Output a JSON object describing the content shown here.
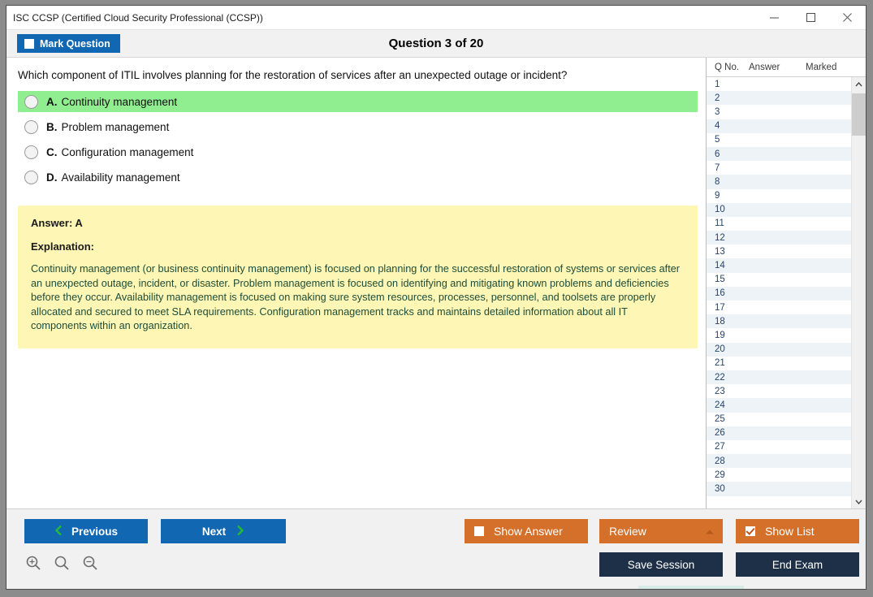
{
  "window": {
    "title": "ISC CCSP (Certified Cloud Security Professional (CCSP))",
    "minimize_label": "minimize",
    "maximize_label": "maximize",
    "close_label": "close"
  },
  "header": {
    "mark_question_label": "Mark Question",
    "mark_question_checked": false,
    "question_counter": "Question 3 of 20"
  },
  "question": {
    "text": "Which component of ITIL involves planning for the restoration of services after an unexpected outage or incident?",
    "options": [
      {
        "letter": "A.",
        "label": "Continuity management",
        "correct": true
      },
      {
        "letter": "B.",
        "label": "Problem management",
        "correct": false
      },
      {
        "letter": "C.",
        "label": "Configuration management",
        "correct": false
      },
      {
        "letter": "D.",
        "label": "Availability management",
        "correct": false
      }
    ]
  },
  "answer_panel": {
    "answer_line": "Answer: A",
    "explanation_head": "Explanation:",
    "explanation_body": "Continuity management (or business continuity management) is focused on planning for the successful restoration of systems or services after an unexpected outage, incident, or disaster. Problem management is focused on identifying and mitigating known problems and deficiencies before they occur. Availability management is focused on making sure system resources, processes, personnel, and toolsets are properly allocated and secured to meet SLA requirements. Configuration management tracks and maintains detailed information about all IT components within an organization."
  },
  "question_list": {
    "columns": [
      "Q No.",
      "Answer",
      "Marked"
    ],
    "rows": [
      {
        "no": "1",
        "answer": "",
        "marked": ""
      },
      {
        "no": "2",
        "answer": "",
        "marked": ""
      },
      {
        "no": "3",
        "answer": "",
        "marked": ""
      },
      {
        "no": "4",
        "answer": "",
        "marked": ""
      },
      {
        "no": "5",
        "answer": "",
        "marked": ""
      },
      {
        "no": "6",
        "answer": "",
        "marked": ""
      },
      {
        "no": "7",
        "answer": "",
        "marked": ""
      },
      {
        "no": "8",
        "answer": "",
        "marked": ""
      },
      {
        "no": "9",
        "answer": "",
        "marked": ""
      },
      {
        "no": "10",
        "answer": "",
        "marked": ""
      },
      {
        "no": "11",
        "answer": "",
        "marked": ""
      },
      {
        "no": "12",
        "answer": "",
        "marked": ""
      },
      {
        "no": "13",
        "answer": "",
        "marked": ""
      },
      {
        "no": "14",
        "answer": "",
        "marked": ""
      },
      {
        "no": "15",
        "answer": "",
        "marked": ""
      },
      {
        "no": "16",
        "answer": "",
        "marked": ""
      },
      {
        "no": "17",
        "answer": "",
        "marked": ""
      },
      {
        "no": "18",
        "answer": "",
        "marked": ""
      },
      {
        "no": "19",
        "answer": "",
        "marked": ""
      },
      {
        "no": "20",
        "answer": "",
        "marked": ""
      },
      {
        "no": "21",
        "answer": "",
        "marked": ""
      },
      {
        "no": "22",
        "answer": "",
        "marked": ""
      },
      {
        "no": "23",
        "answer": "",
        "marked": ""
      },
      {
        "no": "24",
        "answer": "",
        "marked": ""
      },
      {
        "no": "25",
        "answer": "",
        "marked": ""
      },
      {
        "no": "26",
        "answer": "",
        "marked": ""
      },
      {
        "no": "27",
        "answer": "",
        "marked": ""
      },
      {
        "no": "28",
        "answer": "",
        "marked": ""
      },
      {
        "no": "29",
        "answer": "",
        "marked": ""
      },
      {
        "no": "30",
        "answer": "",
        "marked": ""
      }
    ]
  },
  "toolbar": {
    "previous_label": "Previous",
    "next_label": "Next",
    "show_answer_label": "Show Answer",
    "show_answer_checked": false,
    "review_label": "Review",
    "show_list_label": "Show List",
    "show_list_checked": true,
    "save_session_label": "Save Session",
    "end_exam_label": "End Exam",
    "zoom_in_label": "zoom-in",
    "zoom_reset_label": "zoom-reset",
    "zoom_out_label": "zoom-out"
  },
  "colors": {
    "primary_blue": "#1267b2",
    "orange": "#d4702a",
    "navy": "#1e3048",
    "correct_green": "#90ee90",
    "answer_yellow": "#fdf6b5",
    "chevron_green": "#22bb33",
    "explanation_text": "#1e4d3a"
  }
}
